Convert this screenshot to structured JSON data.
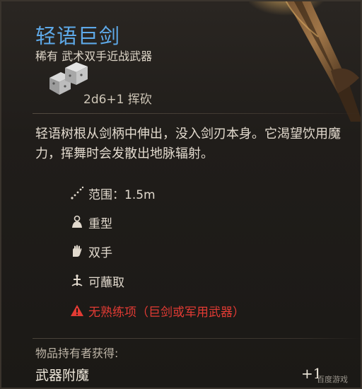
{
  "item": {
    "name": "轻语巨剑",
    "subtitle": "稀有 武术双手近战武器",
    "damage": "2d6+1 挥砍",
    "description": "轻语树根从剑柄中伸出，没入剑刃本身。它渴望饮用魔力，挥舞时会发散出地脉辐射。"
  },
  "properties": [
    {
      "icon": "range-icon",
      "label": "范围：1.5m"
    },
    {
      "icon": "heavy-icon",
      "label": "重型"
    },
    {
      "icon": "two-handed-icon",
      "label": "双手"
    },
    {
      "icon": "dippable-icon",
      "label": "可蘸取"
    },
    {
      "icon": "warning-icon",
      "label": "无熟练项（巨剑或军用武器）"
    }
  ],
  "footer": {
    "holder_label": "物品持有者获得:",
    "enchant_label": "武器附魔",
    "enchant_value": "+1"
  },
  "watermark": "百度游戏",
  "colors": {
    "title": "#5ea9e8",
    "warning": "#e33b34",
    "text": "#e2dace"
  }
}
